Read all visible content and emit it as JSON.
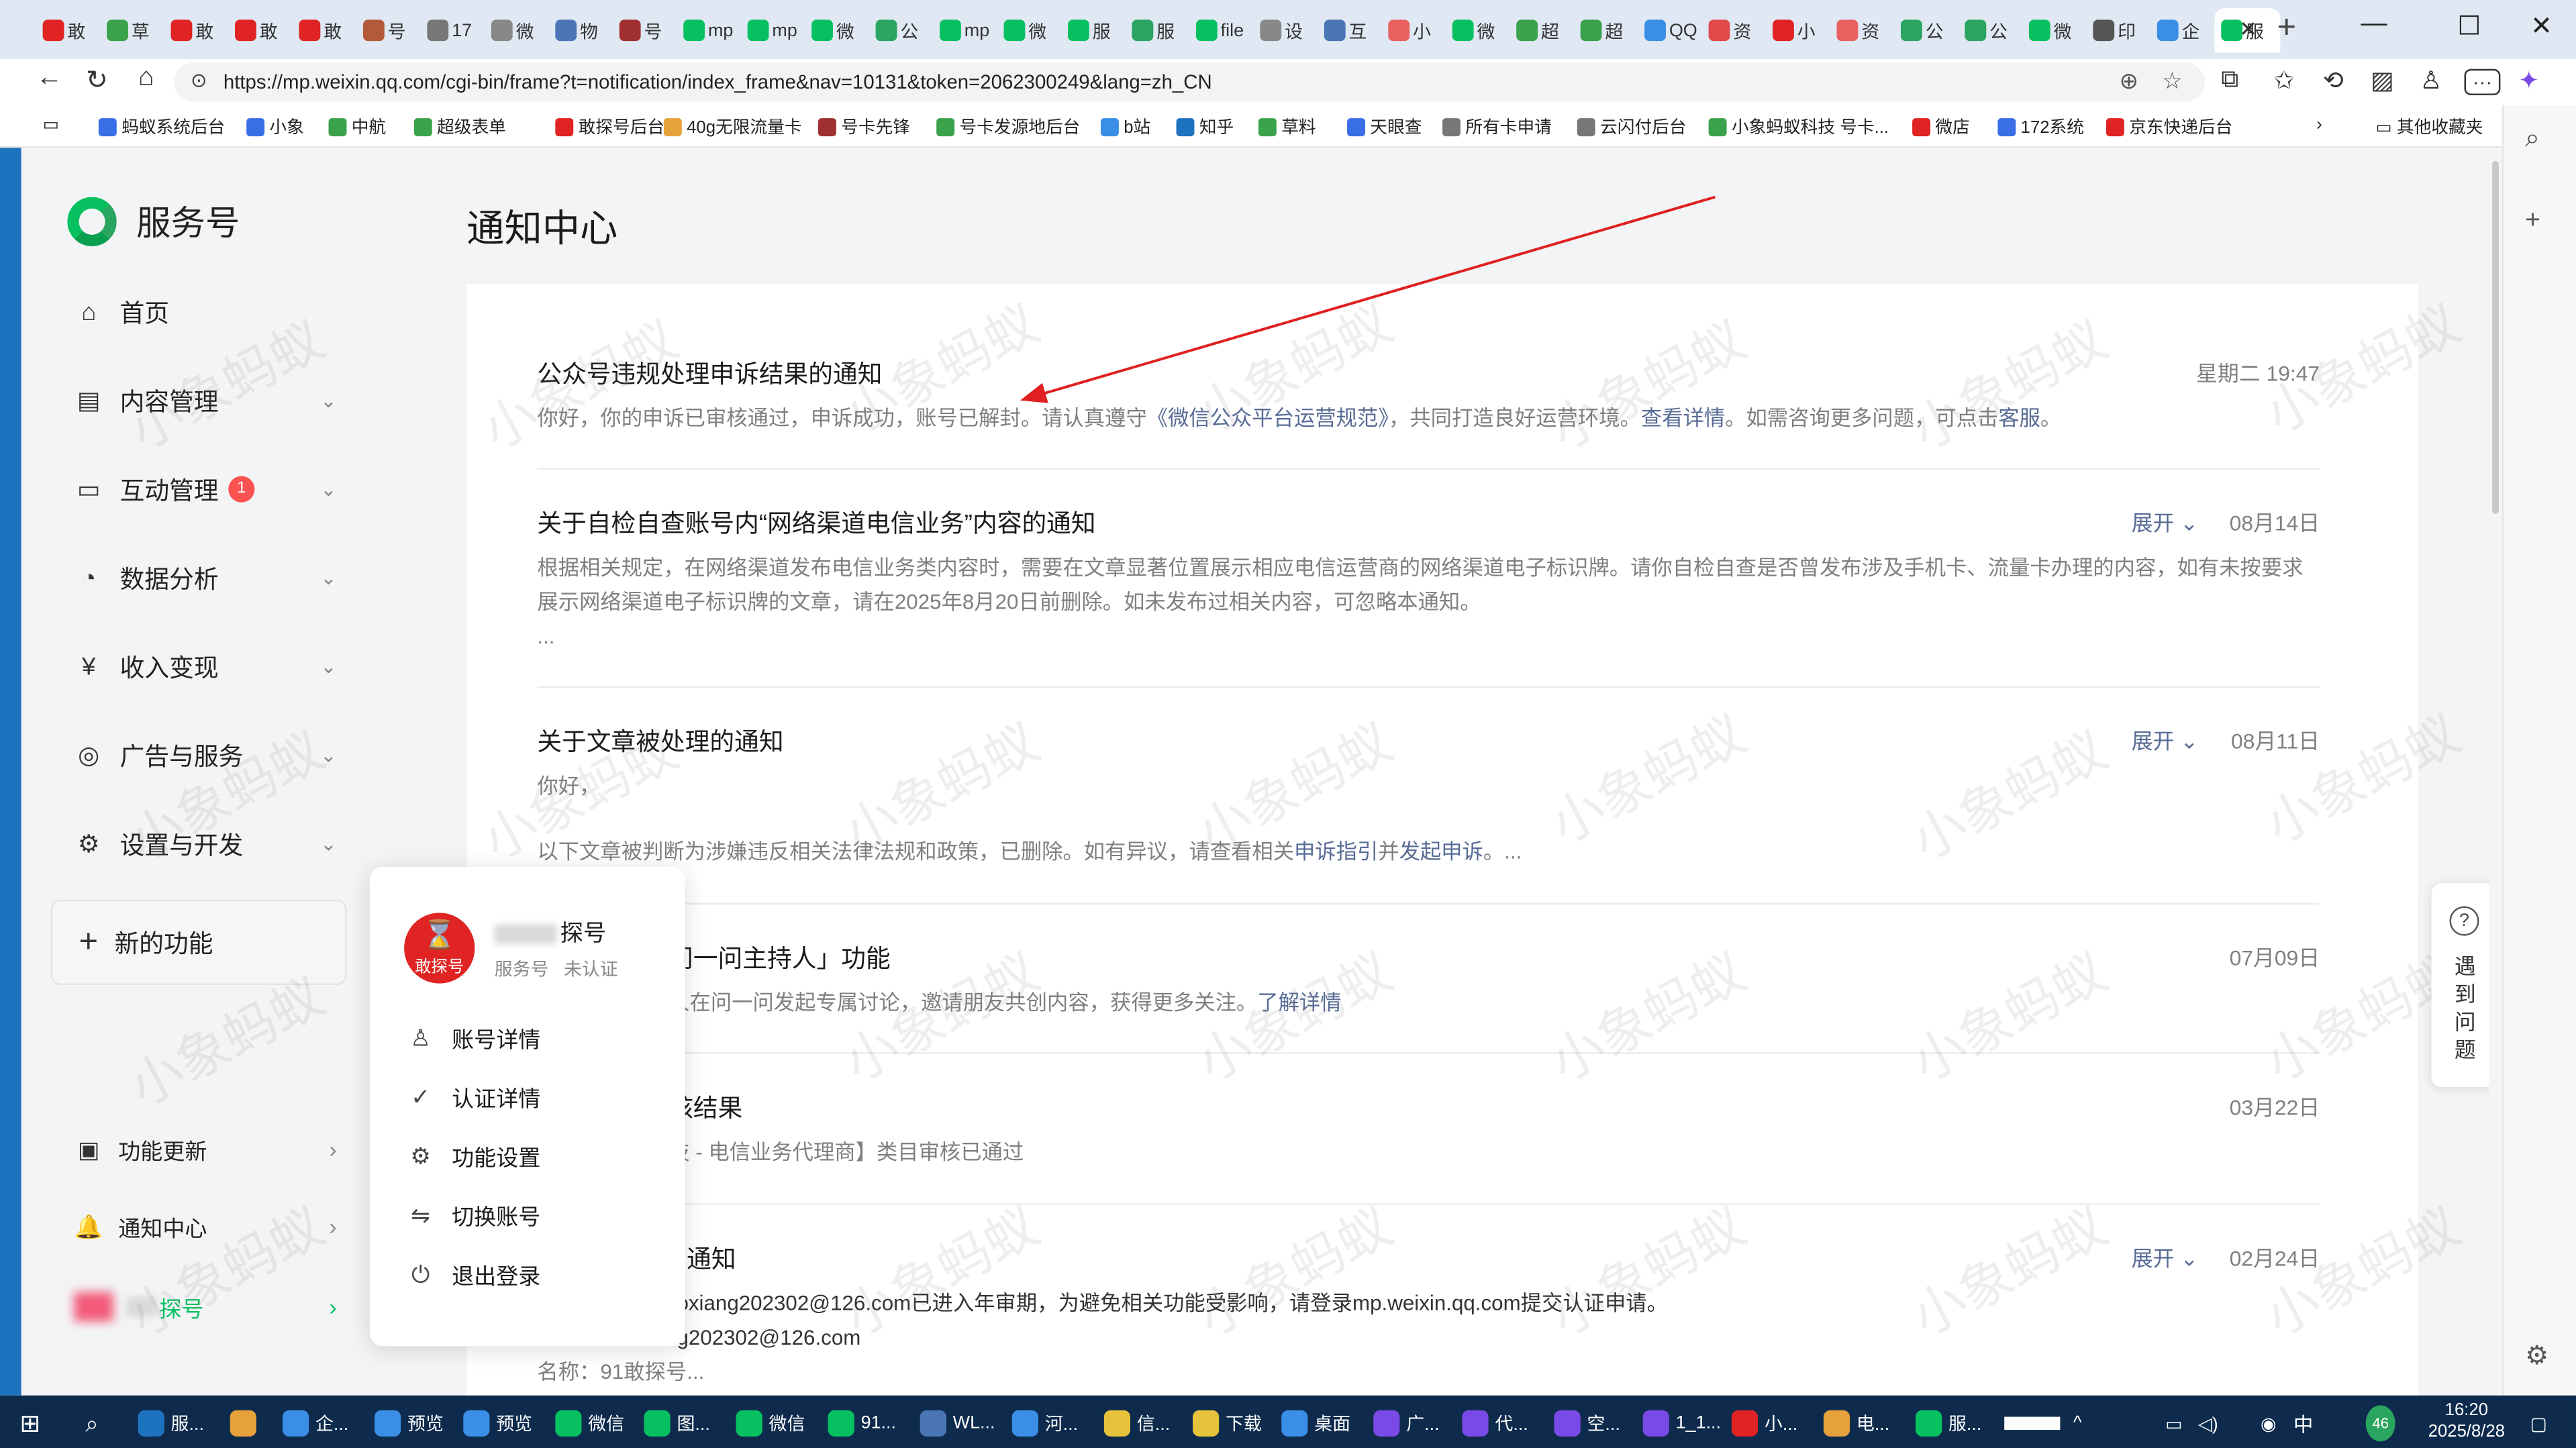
{
  "browser": {
    "tabs": [
      {
        "label": "敢",
        "color": "#e02323"
      },
      {
        "label": "草",
        "color": "#3aa24a"
      },
      {
        "label": "敢",
        "color": "#e02323"
      },
      {
        "label": "敢",
        "color": "#e02323"
      },
      {
        "label": "敢",
        "color": "#e02323"
      },
      {
        "label": "号",
        "color": "#b35a3a"
      },
      {
        "label": "17",
        "color": "#777777"
      },
      {
        "label": "微",
        "color": "#888888"
      },
      {
        "label": "物",
        "color": "#4a76b8"
      },
      {
        "label": "号",
        "color": "#a03030"
      },
      {
        "label": "mp",
        "color": "#07c160"
      },
      {
        "label": "mp",
        "color": "#07c160"
      },
      {
        "label": "微",
        "color": "#07c160"
      },
      {
        "label": "公",
        "color": "#2aa55f"
      },
      {
        "label": "mp",
        "color": "#07c160"
      },
      {
        "label": "微",
        "color": "#07c160"
      },
      {
        "label": "服",
        "color": "#07c160"
      },
      {
        "label": "服",
        "color": "#2aa55f"
      },
      {
        "label": "file",
        "color": "#07c160"
      },
      {
        "label": "设",
        "color": "#888888"
      },
      {
        "label": "互",
        "color": "#4a76b8"
      },
      {
        "label": "小",
        "color": "#e86060"
      },
      {
        "label": "微",
        "color": "#07c160"
      },
      {
        "label": "超",
        "color": "#3aa24a"
      },
      {
        "label": "超",
        "color": "#3aa24a"
      },
      {
        "label": "QQ",
        "color": "#3a8ee6"
      },
      {
        "label": "资",
        "color": "#e04a4a"
      },
      {
        "label": "小",
        "color": "#e02323"
      },
      {
        "label": "资",
        "color": "#e86060"
      },
      {
        "label": "公",
        "color": "#2aa55f"
      },
      {
        "label": "公",
        "color": "#2aa55f"
      },
      {
        "label": "微",
        "color": "#07c160"
      },
      {
        "label": "印",
        "color": "#555555"
      },
      {
        "label": "企",
        "color": "#3a8ee6"
      },
      {
        "label": "服",
        "color": "#07c160"
      }
    ],
    "new_tab": "+",
    "close_tab": "✕",
    "url": "https://mp.weixin.qq.com/cgi-bin/frame?t=notification/index_frame&nav=10131&token=2062300249&lang=zh_CN",
    "window_controls": {
      "minimize": "—",
      "maximize": "☐",
      "close": "✕"
    },
    "bookmarks": [
      {
        "label": "蚂蚁系统后台",
        "color": "#3a6ee6"
      },
      {
        "label": "小象",
        "color": "#3a6ee6"
      },
      {
        "label": "中航",
        "color": "#3aa24a"
      },
      {
        "label": "超级表单",
        "color": "#3aa24a"
      },
      {
        "label": "敢探号后台",
        "color": "#e02323"
      },
      {
        "label": "40g无限流量卡",
        "color": "#e6a13a"
      },
      {
        "label": "号卡先锋",
        "color": "#a03030"
      },
      {
        "label": "号卡发源地后台",
        "color": "#3aa24a"
      },
      {
        "label": "b站",
        "color": "#3a8ee6"
      },
      {
        "label": "知乎",
        "color": "#1e73be"
      },
      {
        "label": "草料",
        "color": "#3aa24a"
      },
      {
        "label": "天眼查",
        "color": "#3a6ee6"
      },
      {
        "label": "所有卡申请",
        "color": "#777777"
      },
      {
        "label": "云闪付后台",
        "color": "#777777"
      },
      {
        "label": "小象蚂蚁科技 号卡...",
        "color": "#3aa24a"
      },
      {
        "label": "微店",
        "color": "#e02323"
      },
      {
        "label": "172系统",
        "color": "#3a6ee6"
      },
      {
        "label": "京东快递后台",
        "color": "#e02323"
      }
    ],
    "bookmarks_more": "›",
    "other_favorites": "其他收藏夹"
  },
  "sidebar": {
    "logo_text": "服务号",
    "items": [
      {
        "label": "首页",
        "icon": "home-icon",
        "glyph": "⌂"
      },
      {
        "label": "内容管理",
        "icon": "document-icon",
        "glyph": "▤"
      },
      {
        "label": "互动管理",
        "icon": "message-icon",
        "glyph": "▭",
        "badge": "1"
      },
      {
        "label": "数据分析",
        "icon": "chart-icon",
        "glyph": "◔"
      },
      {
        "label": "收入变现",
        "icon": "yen-icon",
        "glyph": "¥"
      },
      {
        "label": "广告与服务",
        "icon": "compass-icon",
        "glyph": "◎"
      },
      {
        "label": "设置与开发",
        "icon": "gear-icon",
        "glyph": "⚙"
      }
    ],
    "new_features": "新的功能",
    "bottom": [
      {
        "label": "功能更新",
        "icon": "update-icon",
        "glyph": "▣"
      },
      {
        "label": "通知中心",
        "icon": "bell-icon",
        "glyph": "🔔"
      }
    ],
    "account_label": "探号"
  },
  "main": {
    "title": "通知中心",
    "notifications": [
      {
        "title": "公众号违规处理申诉结果的通知",
        "date": "星期二 19:47",
        "desc_pre": "你好，你的申诉已审核通过，申诉成功，账号已解封。请认真遵守",
        "desc_link1": "《微信公众平台运营规范》",
        "desc_mid": "，共同打造良好运营环境。",
        "desc_link2": "查看详情",
        "desc_mid2": "。如需咨询更多问题，可点击",
        "desc_link3": "客服",
        "desc_post": "。"
      },
      {
        "title": "关于自检自查账号内“网络渠道电信业务”内容的通知",
        "date": "08月14日",
        "expand": "展开",
        "desc": "根据相关规定，在网络渠道发布电信业务类内容时，需要在文章显著位置展示相应电信运营商的网络渠道电子标识牌。请你自检自查是否曾发布涉及手机卡、流量卡办理的内容，如有未按要求展示网络渠道电子标识牌的文章，请在2025年8月20日前删除。如未发布过相关内容，可忽略本通知。",
        "more": "..."
      },
      {
        "title": "关于文章被处理的通知",
        "date": "08月11日",
        "expand": "展开",
        "desc": "你好，",
        "desc2_pre": "以下文章被判断为涉嫌违反相关法律法规和政策，已删除。如有异议，请查看相关",
        "desc2_link1": "申诉指引",
        "desc2_mid": "并",
        "desc2_link2": "发起申诉",
        "desc2_post": "。..."
      },
      {
        "title": "问一问主持人」功能",
        "date": "07月09日",
        "desc_pre": "人在问一问发起专属讨论，邀请朋友共创内容，获得更多关注。",
        "desc_link": "了解详情"
      },
      {
        "title": "核结果",
        "date": "03月22日",
        "desc": "技 - 电信业务代理商】类目审核已通过"
      },
      {
        "title": "通知",
        "date": "02月24日",
        "expand": "展开",
        "desc": "oxiang202302@126.com已进入年审期，为避免相关功能受影响，请登录mp.weixin.qq.com提交认证申请。",
        "desc2": "g202302@126.com",
        "desc3": "名称：91敢探号..."
      }
    ]
  },
  "popup": {
    "avatar_text": "敢探号",
    "name": "探号",
    "type": "服务号",
    "status": "未认证",
    "items": [
      {
        "label": "账号详情",
        "icon": "user-icon",
        "glyph": "♙"
      },
      {
        "label": "认证详情",
        "icon": "check-circle-icon",
        "glyph": "✓"
      },
      {
        "label": "功能设置",
        "icon": "gear-icon",
        "glyph": "⚙"
      },
      {
        "label": "切换账号",
        "icon": "switch-icon",
        "glyph": "⇋"
      },
      {
        "label": "退出登录",
        "icon": "power-icon",
        "glyph": "⏻"
      }
    ]
  },
  "help": {
    "label": "遇到问题",
    "glyph": "?"
  },
  "watermark": "小象蚂蚁",
  "taskbar": {
    "items": [
      {
        "label": "服...",
        "color": "#1e73be"
      },
      {
        "label": "",
        "color": "#e6a13a"
      },
      {
        "label": "企...",
        "color": "#3a8ee6"
      },
      {
        "label": "预览",
        "color": "#3a8ee6"
      },
      {
        "label": "预览",
        "color": "#3a8ee6"
      },
      {
        "label": "微信",
        "color": "#07c160"
      },
      {
        "label": "图...",
        "color": "#07c160"
      },
      {
        "label": "微信",
        "color": "#07c160"
      },
      {
        "label": "91...",
        "color": "#07c160"
      },
      {
        "label": "WL...",
        "color": "#4a76b8"
      },
      {
        "label": "河...",
        "color": "#3a8ee6"
      },
      {
        "label": "信...",
        "color": "#e6c33a"
      },
      {
        "label": "下载",
        "color": "#e6c33a"
      },
      {
        "label": "桌面",
        "color": "#3a8ee6"
      },
      {
        "label": "广...",
        "color": "#7a4ae6"
      },
      {
        "label": "代...",
        "color": "#7a4ae6"
      },
      {
        "label": "空...",
        "color": "#7a4ae6"
      },
      {
        "label": "1_1...",
        "color": "#7a4ae6"
      },
      {
        "label": "小...",
        "color": "#e02323"
      },
      {
        "label": "电...",
        "color": "#e6a13a"
      },
      {
        "label": "服...",
        "color": "#07c160"
      }
    ],
    "ime": "中",
    "temp": "46",
    "time": "16:20",
    "date": "2025/8/28"
  },
  "colors": {
    "accent": "#07c160",
    "link": "#576b95",
    "badge": "#fa5151",
    "arrow": "#e02020"
  }
}
